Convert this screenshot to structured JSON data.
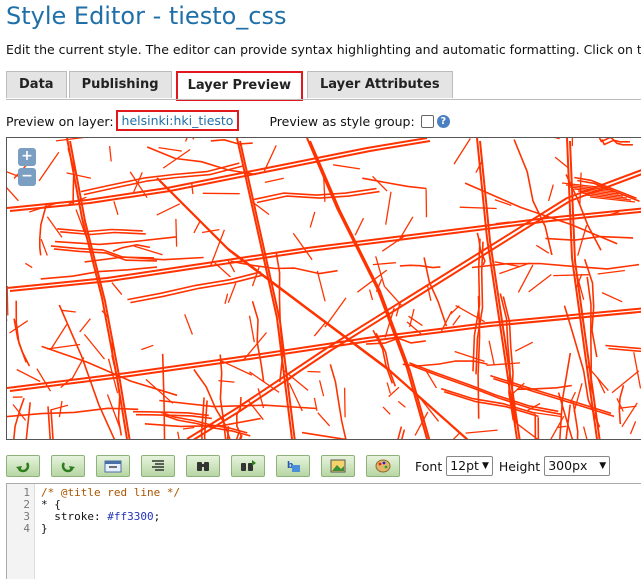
{
  "page": {
    "title": "Style Editor - tiesto_css",
    "description": "Edit the current style. The editor can provide syntax highlighting and automatic formatting. Click on the \""
  },
  "tabs": [
    {
      "label": "Data",
      "active": false
    },
    {
      "label": "Publishing",
      "active": false
    },
    {
      "label": "Layer Preview",
      "active": true
    },
    {
      "label": "Layer Attributes",
      "active": false
    }
  ],
  "preview": {
    "layer_label": "Preview on layer:",
    "layer_name": "helsinki:hki_tiesto",
    "group_label": "Preview as style group:",
    "group_checked": false,
    "help_icon": "help-icon"
  },
  "map": {
    "stroke_color": "#ff3300",
    "zoom_in": "+",
    "zoom_out": "−"
  },
  "toolbar": {
    "buttons": [
      "undo-icon",
      "redo-icon",
      "go-to-line-icon",
      "auto-format-icon",
      "find-icon",
      "replace-icon",
      "color-picker-icon",
      "image-icon",
      "palette-icon"
    ],
    "font_label": "Font",
    "font_value": "12pt",
    "height_label": "Height",
    "height_value": "300px"
  },
  "editor": {
    "line_numbers": [
      "1",
      "2",
      "3",
      "4"
    ],
    "lines": {
      "l1_comment": "/* @title red line */",
      "l2": "* {",
      "l3_prop": "  stroke: ",
      "l3_value": "#ff3300",
      "l3_end": ";",
      "l4": "}"
    }
  }
}
